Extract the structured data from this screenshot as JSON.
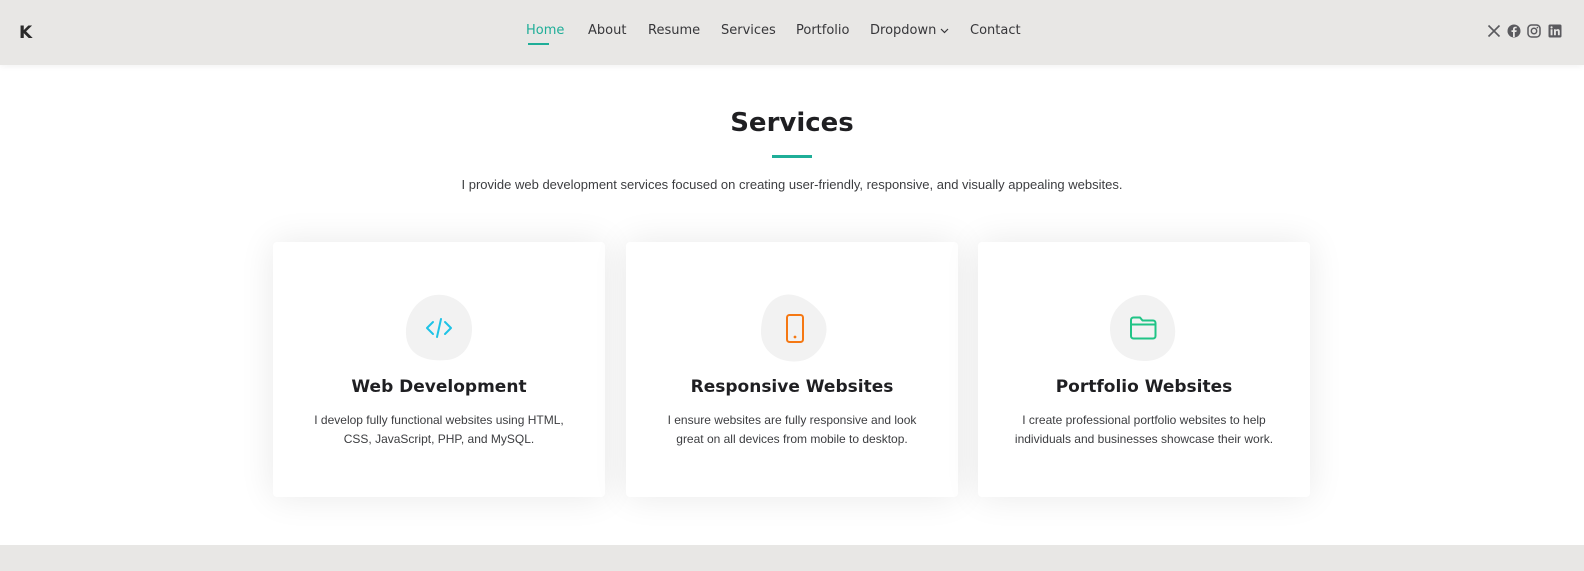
{
  "header": {
    "logo": "K",
    "nav": [
      {
        "label": "Home",
        "active": true
      },
      {
        "label": "About"
      },
      {
        "label": "Resume"
      },
      {
        "label": "Services"
      },
      {
        "label": "Portfolio"
      },
      {
        "label": "Dropdown",
        "has_dropdown": true
      },
      {
        "label": "Contact"
      }
    ],
    "social_icons": [
      "x-icon",
      "facebook-icon",
      "instagram-icon",
      "linkedin-icon"
    ]
  },
  "section": {
    "title": "Services",
    "description": "I provide web development services focused on creating user-friendly, responsive, and visually appealing websites."
  },
  "services": [
    {
      "icon": "code-icon",
      "icon_color": "#1ec3e6",
      "title": "Web Development",
      "description": "I develop fully functional websites using HTML, CSS, JavaScript, PHP, and MySQL."
    },
    {
      "icon": "phone-icon",
      "icon_color": "#f57813",
      "title": "Responsive Websites",
      "description": "I ensure websites are fully responsive and look great on all devices from mobile to desktop."
    },
    {
      "icon": "folder-icon",
      "icon_color": "#20c486",
      "title": "Portfolio Websites",
      "description": "I create professional portfolio websites to help individuals and businesses showcase their work."
    }
  ],
  "colors": {
    "accent": "#1fae98",
    "header_bg": "#e8e7e5",
    "text_dark": "#1f1f22",
    "blob_bg": "#f2f2f2"
  }
}
